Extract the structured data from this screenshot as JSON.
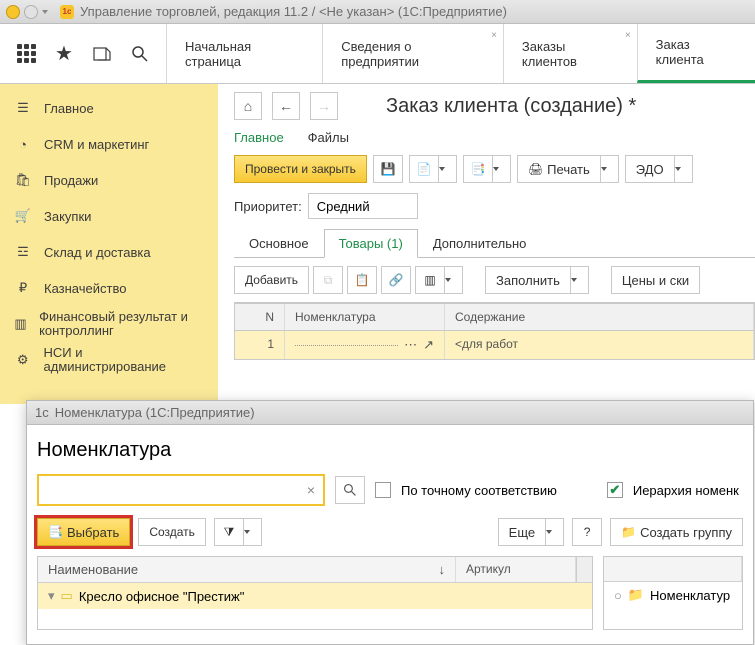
{
  "titlebar": {
    "text": "Управление торговлей, редакция 11.2 / <Не указан>  (1С:Предприятие)",
    "logo": "1с"
  },
  "top_tabs": [
    "Начальная страница",
    "Сведения о предприятии",
    "Заказы клиентов",
    "Заказ клиента"
  ],
  "sidebar": {
    "items": [
      {
        "label": "Главное",
        "icon": "menu"
      },
      {
        "label": "CRM и маркетинг",
        "icon": "pie"
      },
      {
        "label": "Продажи",
        "icon": "bag"
      },
      {
        "label": "Закупки",
        "icon": "cart"
      },
      {
        "label": "Склад и доставка",
        "icon": "box"
      },
      {
        "label": "Казначейство",
        "icon": "coin"
      },
      {
        "label": "Финансовый результат и контроллинг",
        "icon": "bars"
      },
      {
        "label": "НСИ и администрирование",
        "icon": "gear"
      }
    ]
  },
  "main": {
    "title": "Заказ клиента (создание) *",
    "subtabs": {
      "main": "Главное",
      "files": "Файлы"
    },
    "actions": {
      "post_close": "Провести и закрыть",
      "print": "Печать",
      "edo": "ЭДО"
    },
    "priority": {
      "label": "Приоритет:",
      "value": "Средний"
    },
    "inner_tabs": [
      "Основное",
      "Товары (1)",
      "Дополнительно"
    ],
    "add_btn": "Добавить",
    "fill_btn": "Заполнить",
    "prices_btn": "Цены и ски",
    "table": {
      "headers": {
        "n": "N",
        "nom": "Номенклатура",
        "sod": "Содержание"
      },
      "rows": [
        {
          "n": "1",
          "nom": "",
          "sod_placeholder": "<для работ"
        }
      ]
    }
  },
  "modal": {
    "title": "Номенклатура  (1С:Предприятие)",
    "heading": "Номенклатура",
    "exact_match": "По точному соответствию",
    "hierarchy": "Иерархия номенк",
    "select_btn": "Выбрать",
    "create_btn": "Создать",
    "more_btn": "Еще",
    "create_group": "Создать группу",
    "columns": {
      "name": "Наименование",
      "art": "Артикул"
    },
    "side_col": "Номенклатур",
    "rows": [
      {
        "name": "Кресло офисное \"Престиж\""
      }
    ]
  }
}
